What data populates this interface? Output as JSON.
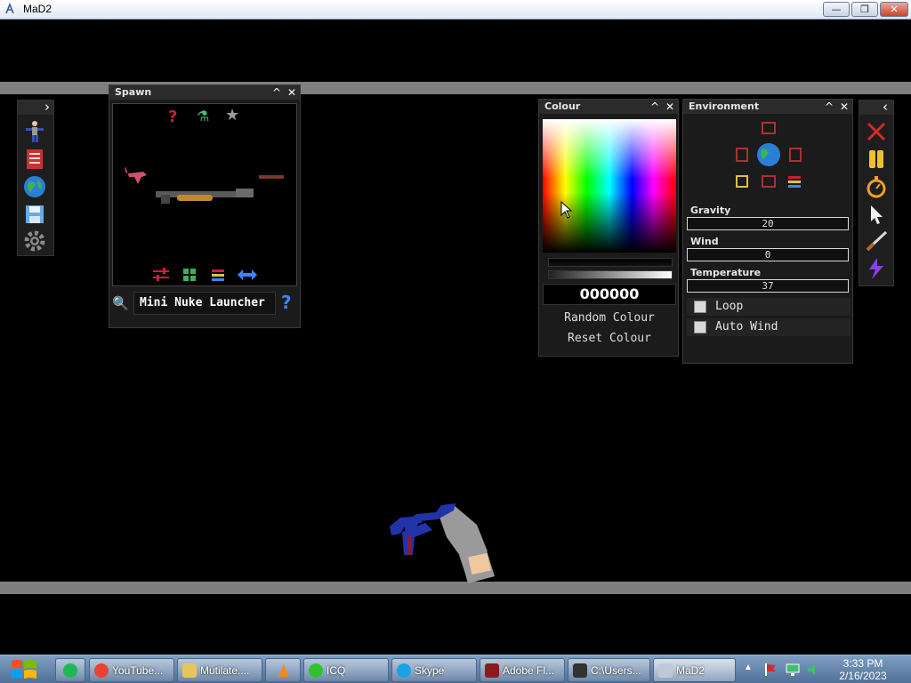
{
  "window": {
    "title": "MaD2",
    "minimize": "—",
    "restore": "❐",
    "close": "✕"
  },
  "left_toolbar": {
    "toggle": "›",
    "tools": [
      "ragdoll-icon",
      "book-icon",
      "globe-icon",
      "save-icon",
      "gear-icon"
    ]
  },
  "spawn": {
    "title": "Spawn",
    "collapse": "^",
    "close": "✕",
    "top_icons": {
      "help": "?",
      "potion": "⚗",
      "star": "★"
    },
    "bottom_icons": [
      "sliders-icon",
      "grid-icon",
      "stack-icon",
      "arrows-icon"
    ],
    "search_icon": "🔍",
    "selected_item": "Mini Nuke Launcher",
    "help_icon": "?"
  },
  "colour": {
    "title": "Colour",
    "collapse": "^",
    "close": "✕",
    "hex_value": "000000",
    "random_button": "Random Colour",
    "reset_button": "Reset Colour"
  },
  "environment": {
    "title": "Environment",
    "collapse": "^",
    "close": "✕",
    "gravity_label": "Gravity",
    "gravity_value": "20",
    "wind_label": "Wind",
    "wind_value": "0",
    "temperature_label": "Temperature",
    "temperature_value": "37",
    "loop_label": "Loop",
    "auto_wind_label": "Auto Wind"
  },
  "right_toolbar": {
    "toggle": "‹",
    "tools": [
      "close-x-icon",
      "pause-icon",
      "timer-icon",
      "cursor-icon",
      "knife-icon",
      "lightning-icon"
    ]
  },
  "taskbar": {
    "items": [
      {
        "label": "YouTube...",
        "color": "#e94235"
      },
      {
        "label": "Mutilate....",
        "color": "#e8c55a"
      },
      {
        "label": "",
        "color": "#f08a1c"
      },
      {
        "label": "ICQ",
        "color": "#2ec22e"
      },
      {
        "label": "Skype",
        "color": "#1aa1e6"
      },
      {
        "label": "Adobe Fl...",
        "color": "#8a1b1b"
      },
      {
        "label": "C:\\Users...",
        "color": "#333333"
      },
      {
        "label": "MaD2",
        "color": "#c0c8d8"
      }
    ],
    "time": "3:33 PM",
    "date": "2/16/2023"
  },
  "colors": {
    "spawn_red": "#c8203a",
    "accent_blue": "#3a86ff",
    "gauge_white": "#ffffff"
  }
}
